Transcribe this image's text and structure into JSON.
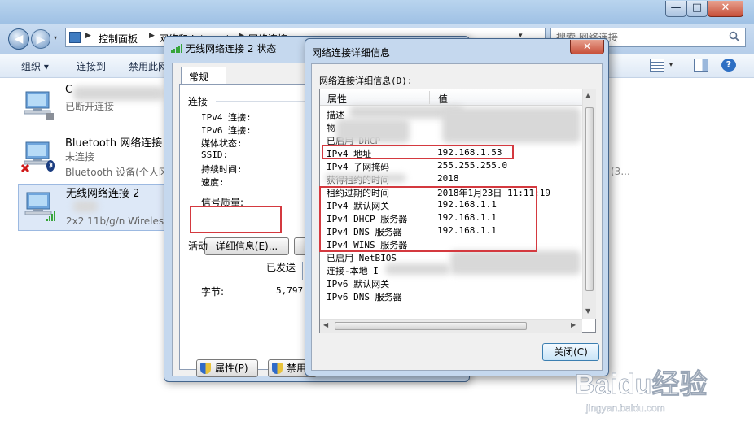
{
  "explorer": {
    "window_controls": {
      "minimize": "—",
      "maximize": "□",
      "close": "✕"
    },
    "nav": {
      "back": "◀",
      "forward": "▶",
      "dropdown": "▾"
    },
    "breadcrumbs": [
      "控制面板",
      "网络和 Internet",
      "网络连接"
    ],
    "crumb_arrow": "▶",
    "address_dropdown": "▾",
    "refresh": "↻",
    "search": {
      "placeholder": "搜索 网络连接"
    },
    "toolbar": {
      "organize": "组织 ▾",
      "connect_to": "连接到",
      "disable": "禁用此网",
      "view_dropdown": "▾",
      "help": "?"
    },
    "connections": [
      {
        "name": "C",
        "status": "已断开连接",
        "device": ""
      },
      {
        "name": "Bluetooth 网络连接",
        "status": "未连接",
        "device": "Bluetooth 设备(个人区"
      },
      {
        "name": "无线网络连接 2",
        "status": "",
        "device": "2x2 11b/g/n Wireless"
      }
    ],
    "right_device_text": "(3..."
  },
  "status_dialog": {
    "title": "无线网络连接 2 状态",
    "tab": "常规",
    "connection_group": "连接",
    "rows": [
      "IPv4 连接:",
      "IPv6 连接:",
      "媒体状态:",
      "SSID:",
      "持续时间:",
      "速度:"
    ],
    "signal_quality": "信号质量:",
    "details_button": "详细信息(E)...",
    "activity_group": "活动",
    "sent_label": "已发送",
    "bytes_label": "字节:",
    "bytes_sent": "5,797,",
    "properties_button": "属性(P)",
    "disable_button": "禁用"
  },
  "details_dialog": {
    "title": "网络连接详细信息",
    "close_x": "✕",
    "label": "网络连接详细信息(D):",
    "columns": {
      "property": "属性",
      "value": "值"
    },
    "rows": [
      {
        "p": "描述",
        "v": ""
      },
      {
        "p": "物",
        "v": ""
      },
      {
        "p": "已启用 DHCP",
        "v": ""
      },
      {
        "p": "IPv4 地址",
        "v": "192.168.1.53"
      },
      {
        "p": "IPv4 子网掩码",
        "v": "255.255.255.0"
      },
      {
        "p": "获得租约的时间",
        "v": "2018"
      },
      {
        "p": "租约过期的时间",
        "v": "2018年1月23日 11:11:19"
      },
      {
        "p": "IPv4 默认网关",
        "v": "192.168.1.1"
      },
      {
        "p": "IPv4 DHCP 服务器",
        "v": "192.168.1.1"
      },
      {
        "p": "IPv4 DNS 服务器",
        "v": "192.168.1.1"
      },
      {
        "p": "IPv4 WINS 服务器",
        "v": ""
      },
      {
        "p": "已启用 NetBIOS",
        "v": ""
      },
      {
        "p": "连接-本地 I",
        "v": ""
      },
      {
        "p": "IPv6 默认网关",
        "v": ""
      },
      {
        "p": "IPv6 DNS 服务器",
        "v": ""
      }
    ],
    "scroll": {
      "up": "▲",
      "down": "▼",
      "left": "◀",
      "right": "▶"
    },
    "close_button": "关闭(C)"
  },
  "watermark": {
    "brand": "Baidu经验",
    "url": "jingyan.baidu.com"
  },
  "colors": {
    "highlight": "#d4393f",
    "accent": "#3f7cc1"
  }
}
